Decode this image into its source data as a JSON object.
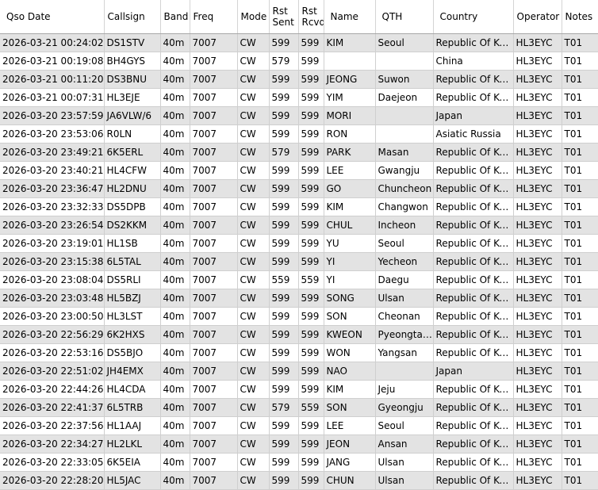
{
  "columns": [
    "Qso Date",
    "Callsign",
    "Band",
    "Freq",
    "Mode",
    "Rst\nSent",
    "Rst\nRcvd",
    "Name",
    "QTH",
    "Country",
    "Operator",
    "Notes"
  ],
  "rows": [
    [
      "2026-03-21 00:24:02",
      "DS1STV",
      "40m",
      "7007",
      "CW",
      "599",
      "599",
      "KIM",
      "Seoul",
      "Republic Of Ko...",
      "HL3EYC",
      "T01"
    ],
    [
      "2026-03-21 00:19:08",
      "BH4GYS",
      "40m",
      "7007",
      "CW",
      "579",
      "599",
      "",
      "",
      "China",
      "HL3EYC",
      "T01"
    ],
    [
      "2026-03-21 00:11:20",
      "DS3BNU",
      "40m",
      "7007",
      "CW",
      "599",
      "599",
      "JEONG",
      "Suwon",
      "Republic Of Ko...",
      "HL3EYC",
      "T01"
    ],
    [
      "2026-03-21 00:07:31",
      "HL3EJE",
      "40m",
      "7007",
      "CW",
      "599",
      "599",
      "YIM",
      "Daejeon",
      "Republic Of Ko...",
      "HL3EYC",
      "T01"
    ],
    [
      "2026-03-20 23:57:59",
      "JA6VLW/6",
      "40m",
      "7007",
      "CW",
      "599",
      "599",
      "MORI",
      "",
      "Japan",
      "HL3EYC",
      "T01"
    ],
    [
      "2026-03-20 23:53:06",
      "R0LN",
      "40m",
      "7007",
      "CW",
      "599",
      "599",
      "RON",
      "",
      "Asiatic Russia",
      "HL3EYC",
      "T01"
    ],
    [
      "2026-03-20 23:49:21",
      "6K5ERL",
      "40m",
      "7007",
      "CW",
      "579",
      "599",
      "PARK",
      "Masan",
      "Republic Of Ko...",
      "HL3EYC",
      "T01"
    ],
    [
      "2026-03-20 23:40:21",
      "HL4CFW",
      "40m",
      "7007",
      "CW",
      "599",
      "599",
      "LEE",
      "Gwangju",
      "Republic Of Ko...",
      "HL3EYC",
      "T01"
    ],
    [
      "2026-03-20 23:36:47",
      "HL2DNU",
      "40m",
      "7007",
      "CW",
      "599",
      "599",
      "GO",
      "Chuncheon",
      "Republic Of Ko...",
      "HL3EYC",
      "T01"
    ],
    [
      "2026-03-20 23:32:33",
      "DS5DPB",
      "40m",
      "7007",
      "CW",
      "599",
      "599",
      "KIM",
      "Changwon",
      "Republic Of Ko...",
      "HL3EYC",
      "T01"
    ],
    [
      "2026-03-20 23:26:54",
      "DS2KKM",
      "40m",
      "7007",
      "CW",
      "599",
      "599",
      "CHUL",
      "Incheon",
      "Republic Of Ko...",
      "HL3EYC",
      "T01"
    ],
    [
      "2026-03-20 23:19:01",
      "HL1SB",
      "40m",
      "7007",
      "CW",
      "599",
      "599",
      "YU",
      "Seoul",
      "Republic Of Ko...",
      "HL3EYC",
      "T01"
    ],
    [
      "2026-03-20 23:15:38",
      "6L5TAL",
      "40m",
      "7007",
      "CW",
      "599",
      "599",
      "YI",
      "Yecheon",
      "Republic Of Ko...",
      "HL3EYC",
      "T01"
    ],
    [
      "2026-03-20 23:08:04",
      "DS5RLI",
      "40m",
      "7007",
      "CW",
      "559",
      "559",
      "YI",
      "Daegu",
      "Republic Of Ko...",
      "HL3EYC",
      "T01"
    ],
    [
      "2026-03-20 23:03:48",
      "HL5BZJ",
      "40m",
      "7007",
      "CW",
      "599",
      "599",
      "SONG",
      "Ulsan",
      "Republic Of Ko...",
      "HL3EYC",
      "T01"
    ],
    [
      "2026-03-20 23:00:50",
      "HL3LST",
      "40m",
      "7007",
      "CW",
      "599",
      "599",
      "SON",
      "Cheonan",
      "Republic Of Ko...",
      "HL3EYC",
      "T01"
    ],
    [
      "2026-03-20 22:56:29",
      "6K2HXS",
      "40m",
      "7007",
      "CW",
      "599",
      "599",
      "KWEON",
      "Pyeongtaek",
      "Republic Of Ko...",
      "HL3EYC",
      "T01"
    ],
    [
      "2026-03-20 22:53:16",
      "DS5BJO",
      "40m",
      "7007",
      "CW",
      "599",
      "599",
      "WON",
      "Yangsan",
      "Republic Of Ko...",
      "HL3EYC",
      "T01"
    ],
    [
      "2026-03-20 22:51:02",
      "JH4EMX",
      "40m",
      "7007",
      "CW",
      "599",
      "599",
      "NAO",
      "",
      "Japan",
      "HL3EYC",
      "T01"
    ],
    [
      "2026-03-20 22:44:26",
      "HL4CDA",
      "40m",
      "7007",
      "CW",
      "599",
      "599",
      "KIM",
      "Jeju",
      "Republic Of Ko...",
      "HL3EYC",
      "T01"
    ],
    [
      "2026-03-20 22:41:37",
      "6L5TRB",
      "40m",
      "7007",
      "CW",
      "579",
      "559",
      "SON",
      "Gyeongju",
      "Republic Of Ko...",
      "HL3EYC",
      "T01"
    ],
    [
      "2026-03-20 22:37:56",
      "HL1AAJ",
      "40m",
      "7007",
      "CW",
      "599",
      "599",
      "LEE",
      "Seoul",
      "Republic Of Ko...",
      "HL3EYC",
      "T01"
    ],
    [
      "2026-03-20 22:34:27",
      "HL2LKL",
      "40m",
      "7007",
      "CW",
      "599",
      "599",
      "JEON",
      "Ansan",
      "Republic Of Ko...",
      "HL3EYC",
      "T01"
    ],
    [
      "2026-03-20 22:33:05",
      "6K5EIA",
      "40m",
      "7007",
      "CW",
      "599",
      "599",
      "JANG",
      "Ulsan",
      "Republic Of Ko...",
      "HL3EYC",
      "T01"
    ],
    [
      "2026-03-20 22:28:20",
      "HL5JAC",
      "40m",
      "7007",
      "CW",
      "599",
      "599",
      "CHUN",
      "Ulsan",
      "Republic Of Ko...",
      "HL3EYC",
      "T01"
    ]
  ]
}
